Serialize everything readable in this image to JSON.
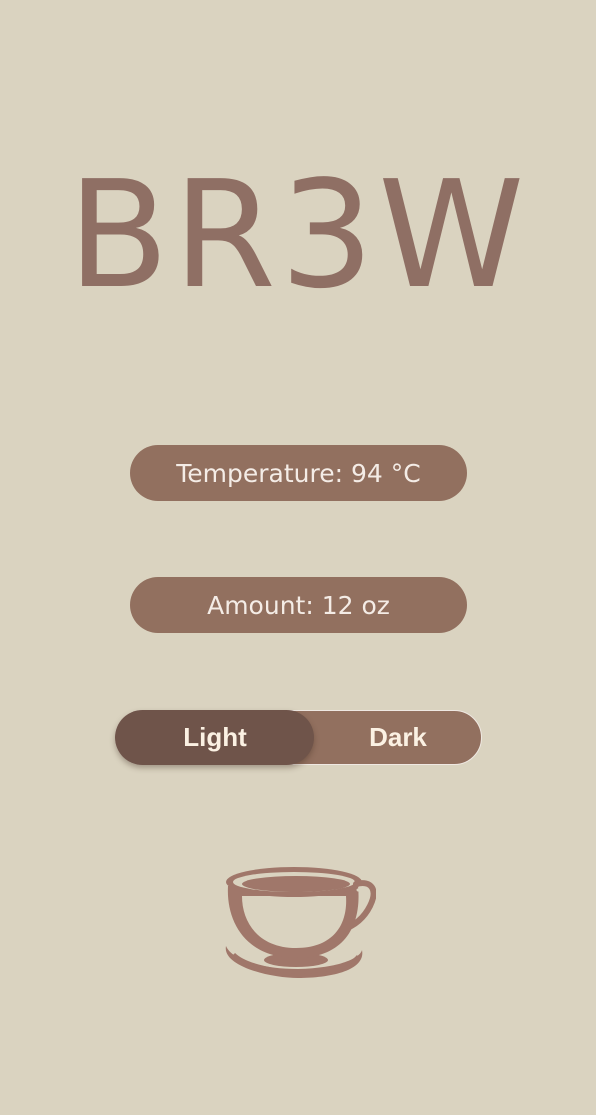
{
  "app": {
    "title": "BR3W"
  },
  "controls": {
    "temperature_label": "Temperature: 94 °C",
    "amount_label": "Amount: 12 oz"
  },
  "roast_toggle": {
    "options": [
      "Light",
      "Dark"
    ],
    "selected": "Light"
  },
  "colors": {
    "background": "#dad3c0",
    "accent": "#92705f",
    "selected": "#6f544a",
    "cup": "#a0776a"
  },
  "icons": {
    "cup": "coffee-cup-icon"
  }
}
